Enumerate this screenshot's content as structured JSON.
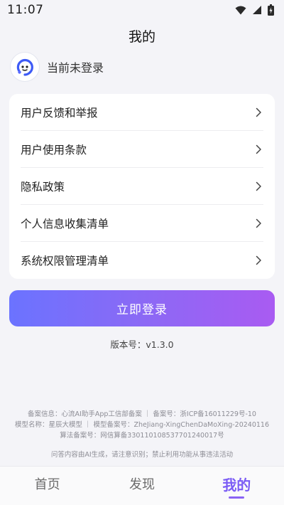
{
  "status_bar": {
    "time": "11:07",
    "icons": [
      "wifi-icon",
      "signal-icon",
      "battery-charging-icon"
    ]
  },
  "page": {
    "title": "我的"
  },
  "user": {
    "login_status": "当前未登录",
    "avatar_icon": "app-logo-icon"
  },
  "menu": {
    "items": [
      {
        "label": "用户反馈和举报",
        "icon": "chevron-right-icon"
      },
      {
        "label": "用户使用条款",
        "icon": "chevron-right-icon"
      },
      {
        "label": "隐私政策",
        "icon": "chevron-right-icon"
      },
      {
        "label": "个人信息收集清单",
        "icon": "chevron-right-icon"
      },
      {
        "label": "系统权限管理清单",
        "icon": "chevron-right-icon"
      }
    ]
  },
  "login_button": {
    "label": "立即登录"
  },
  "version": {
    "text": "版本号：v1.3.0"
  },
  "filing": {
    "line1": "备案信息：心流AI助手App工信部备案 ｜ 备案号：浙ICP备16011229号-10",
    "line2": "模型名称：星辰大模型 ｜ 模型备案号：ZheJiang-XingChenDaMoXing-20240116",
    "line3": "算法备案号：网信算备330110108537701240017号"
  },
  "disclaimer": {
    "text": "问答内容由AI生成，请注意识别；禁止利用功能从事违法活动"
  },
  "bottom_nav": {
    "items": [
      {
        "label": "首页",
        "active": false
      },
      {
        "label": "发现",
        "active": false
      },
      {
        "label": "我的",
        "active": true
      }
    ]
  },
  "colors": {
    "accent": "#7b5cf5",
    "gradient_start": "#6b73ff",
    "gradient_end": "#a95bf2",
    "background": "#f4f4f8"
  }
}
